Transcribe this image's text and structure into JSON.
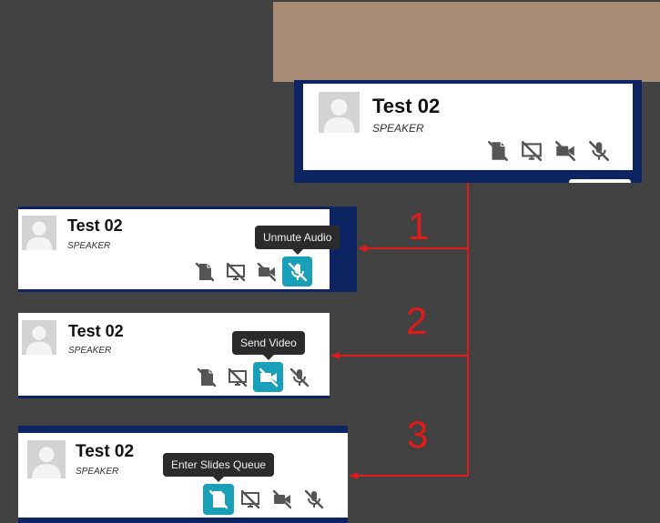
{
  "panels": [
    {
      "id": "top",
      "name": "Test 02",
      "role": "SPEAKER",
      "tooltip": null,
      "active_icon": null
    },
    {
      "id": "step-1",
      "name": "Test 02",
      "role": "SPEAKER",
      "tooltip": "Unmute Audio",
      "active_icon": "mic"
    },
    {
      "id": "step-2",
      "name": "Test 02",
      "role": "SPEAKER",
      "tooltip": "Send Video",
      "active_icon": "video"
    },
    {
      "id": "step-3",
      "name": "Test 02",
      "role": "SPEAKER",
      "tooltip": "Enter Slides Queue",
      "active_icon": "slides"
    }
  ],
  "control_icons": [
    "slides-off-icon",
    "screen-share-off-icon",
    "video-off-icon",
    "mic-off-icon"
  ],
  "step_labels": [
    "1",
    "2",
    "3"
  ],
  "colors": {
    "background": "#424242",
    "tan_block": "#a88c75",
    "card_frame": "#0c2461",
    "active_button": "#1a9fb8",
    "tooltip_bg": "#2b2b2b",
    "annotation_red": "#e31a1a",
    "icon_gray": "#555555"
  }
}
